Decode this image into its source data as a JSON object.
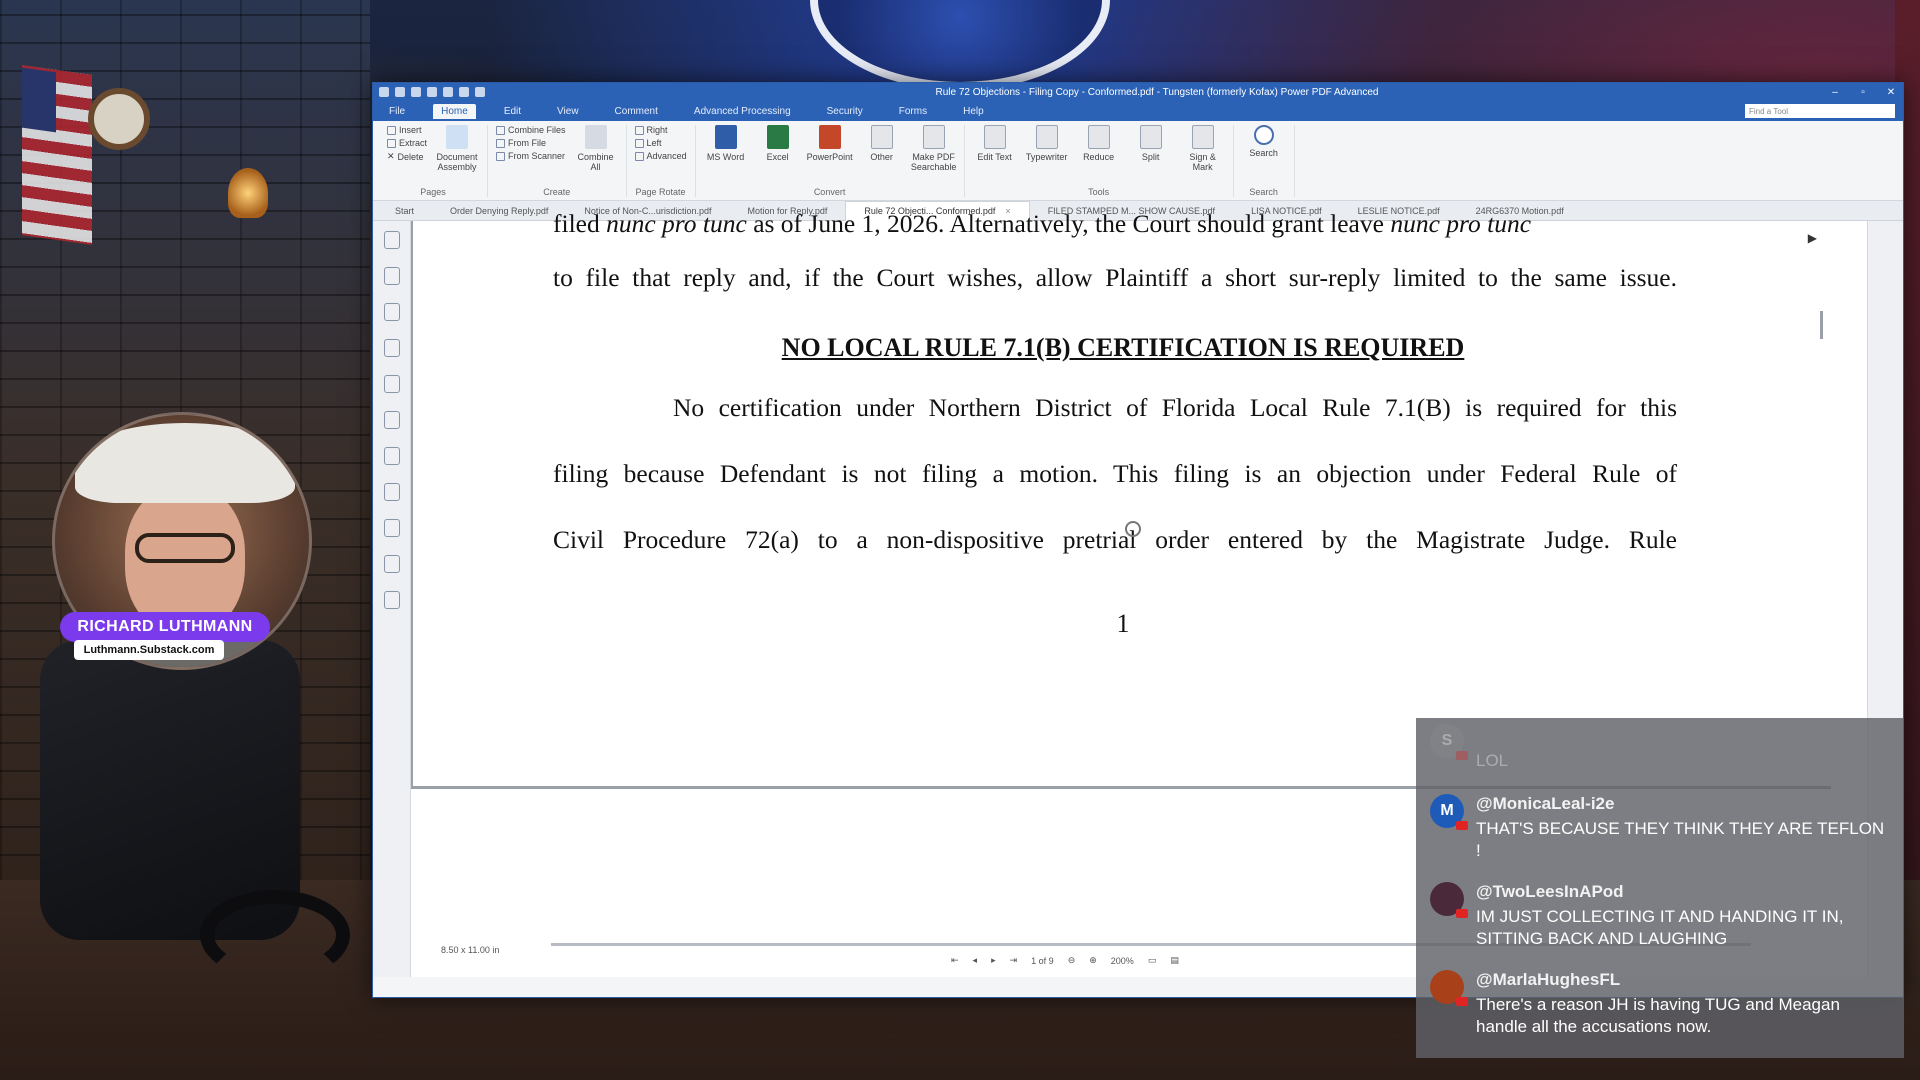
{
  "stream": {
    "host_name": "RICHARD LUTHMANN",
    "host_site": "Luthmann.Substack.com"
  },
  "app": {
    "title": "Rule 72 Objections - Filing Copy - Conformed.pdf - Tungsten (formerly Kofax) Power PDF Advanced",
    "find_placeholder": "Find a Tool",
    "menu": [
      "File",
      "Home",
      "Edit",
      "View",
      "Comment",
      "Advanced Processing",
      "Security",
      "Forms",
      "Help"
    ],
    "ribbon": {
      "pages": {
        "insert": "Insert",
        "extract": "Extract",
        "delete": "Delete",
        "document_assembly": "Document Assembly",
        "label": "Pages"
      },
      "create": {
        "combine_files": "Combine Files",
        "from_file": "From File",
        "from_scanner": "From Scanner",
        "combine_all": "Combine All",
        "label": "Create"
      },
      "rotate": {
        "right": "Right",
        "left": "Left",
        "advanced": "Advanced",
        "label": "Page Rotate"
      },
      "convert": {
        "ms_word": "MS Word",
        "excel": "Excel",
        "powerpoint": "PowerPoint",
        "other": "Other",
        "make_searchable": "Make PDF Searchable",
        "label": "Convert"
      },
      "tools": {
        "edit_text": "Edit Text",
        "typewriter": "Typewriter",
        "reduce": "Reduce",
        "split": "Split",
        "sign_mark": "Sign & Mark",
        "label": "Tools"
      },
      "search": {
        "search": "Search",
        "label": "Search"
      }
    },
    "doc_tabs": [
      "Start",
      "Order Denying Reply.pdf",
      "Notice of Non-C...urisdiction.pdf",
      "Motion for Reply.pdf",
      "Rule 72 Objecti... Conformed.pdf",
      "FILED STAMPED M... SHOW CAUSE.pdf",
      "LISA NOTICE.pdf",
      "LESLIE NOTICE.pdf",
      "24RG6370 Motion.pdf"
    ],
    "active_tab_index": 4,
    "document": {
      "line_top_partial_a": "filed ",
      "line_top_partial_b": "nunc pro tunc",
      "line_top_partial_c": " as of June 1, 2026. Alternatively, the Court should grant leave ",
      "line_top_partial_d": "nunc pro tunc",
      "line_2": "to file that reply and, if the Court wishes, allow Plaintiff a short sur-reply limited to the same issue.",
      "heading": "NO LOCAL RULE 7.1(B) CERTIFICATION IS REQUIRED",
      "para_line_1": "No certification under Northern District of Florida Local Rule 7.1(B) is required for this",
      "para_line_2": "filing because Defendant is not filing a motion. This filing is an objection under Federal Rule of",
      "para_line_3": "Civil Procedure 72(a) to a non-dispositive pretrial order entered by the Magistrate Judge. Rule",
      "page_number": "1"
    },
    "status": {
      "page_size": "8.50 x 11.00 in",
      "page_of": "1 of 9",
      "zoom": "200%"
    }
  },
  "chat": [
    {
      "user": "",
      "initial": "S",
      "text": "LOL",
      "avatar_color": "#8a8a8a"
    },
    {
      "user": "@MonicaLeal-i2e",
      "initial": "M",
      "text": "THAT'S BECAUSE THEY THINK THEY ARE TEFLON !",
      "avatar_color": "#1e5bb8"
    },
    {
      "user": "@TwoLeesInAPod",
      "initial": "",
      "text": "IM JUST COLLECTING IT AND HANDING IT IN, SITTING BACK AND LAUGHING",
      "avatar_color": "#4a2a3a"
    },
    {
      "user": "@MarlaHughesFL",
      "initial": "",
      "text": "There's a reason JH is having TUG and Meagan handle all the accusations now.",
      "avatar_color": "#a8401a"
    }
  ]
}
